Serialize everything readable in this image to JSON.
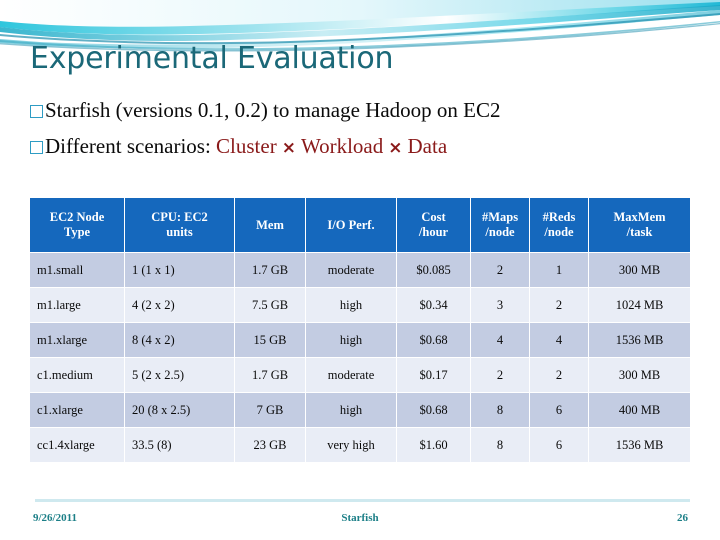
{
  "slide": {
    "title": "Experimental Evaluation",
    "title_color": "#1b6878",
    "accent_color": "#8a1a1a",
    "header_fill": "#1568bd",
    "band_dark": "#c3cce2",
    "band_light": "#e9edf6"
  },
  "bullets": [
    {
      "marker": "hollow-square-bullet",
      "text": "Starfish (versions 0.1, 0.2) to manage Hadoop on EC2"
    },
    {
      "marker": "hollow-square-bullet",
      "lead": "Different scenarios: ",
      "term1": "Cluster",
      "sep1": "×",
      "term2": "Workload",
      "sep2": "×",
      "term3": "Data"
    }
  ],
  "table": {
    "columns": [
      "EC2 Node Type",
      "CPU: EC2 units",
      "Mem",
      "I/O Perf.",
      "Cost /hour",
      "#Maps /node",
      "#Reds /node",
      "MaxMem /task"
    ],
    "columns_lines": [
      [
        "EC2 Node",
        "Type"
      ],
      [
        "CPU: EC2",
        "units"
      ],
      [
        "Mem",
        ""
      ],
      [
        "I/O Perf.",
        ""
      ],
      [
        "Cost",
        "/hour"
      ],
      [
        "#Maps",
        "/node"
      ],
      [
        "#Reds",
        "/node"
      ],
      [
        "MaxMem",
        "/task"
      ]
    ],
    "rows": [
      [
        "m1.small",
        "1 (1 x 1)",
        "1.7 GB",
        "moderate",
        "$0.085",
        "2",
        "1",
        "300 MB"
      ],
      [
        "m1.large",
        "4 (2 x 2)",
        "7.5 GB",
        "high",
        "$0.34",
        "3",
        "2",
        "1024 MB"
      ],
      [
        "m1.xlarge",
        "8 (4 x 2)",
        "15 GB",
        "high",
        "$0.68",
        "4",
        "4",
        "1536 MB"
      ],
      [
        "c1.medium",
        "5 (2 x 2.5)",
        "1.7 GB",
        "moderate",
        "$0.17",
        "2",
        "2",
        "300 MB"
      ],
      [
        "c1.xlarge",
        "20 (8 x 2.5)",
        "7 GB",
        "high",
        "$0.68",
        "8",
        "6",
        "400 MB"
      ],
      [
        "cc1.4xlarge",
        "33.5 (8)",
        "23 GB",
        "very high",
        "$1.60",
        "8",
        "6",
        "1536 MB"
      ]
    ]
  },
  "footer": {
    "date": "9/26/2011",
    "center": "Starfish",
    "page": "26"
  }
}
